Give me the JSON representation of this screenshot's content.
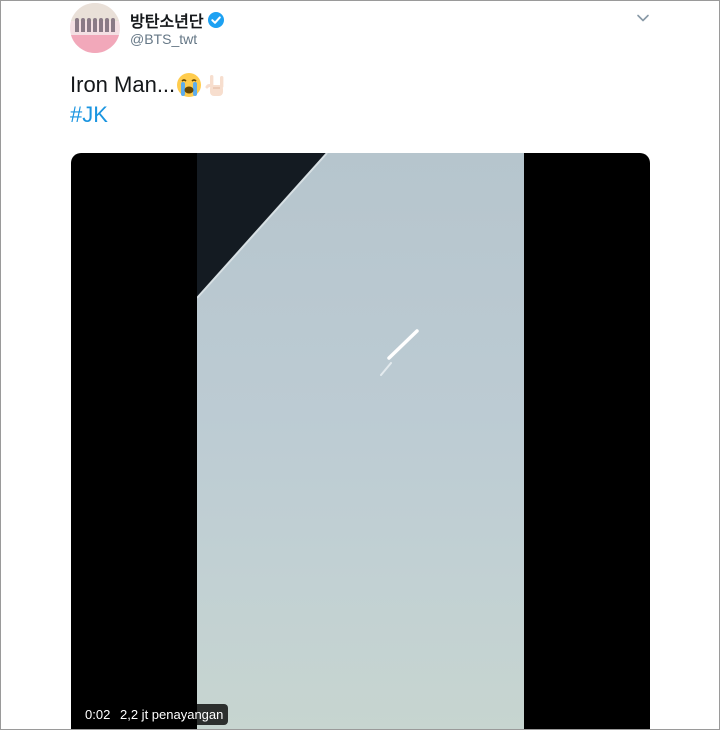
{
  "author": {
    "display_name": "방탄소년단",
    "handle": "@BTS_twt",
    "verified": true
  },
  "tweet": {
    "text": "Iron Man...",
    "emojis": [
      "loudly-crying-face",
      "sign-of-the-horns"
    ],
    "hashtag": "#JK"
  },
  "video": {
    "elapsed": "0:02",
    "views": "2,2 jt penayangan"
  },
  "colors": {
    "hashtag": "#1b95e0",
    "verified": "#1da1f2",
    "handle": "#657786"
  },
  "icons": {
    "verified": "verified-badge-icon",
    "menu": "chevron-down-icon"
  }
}
